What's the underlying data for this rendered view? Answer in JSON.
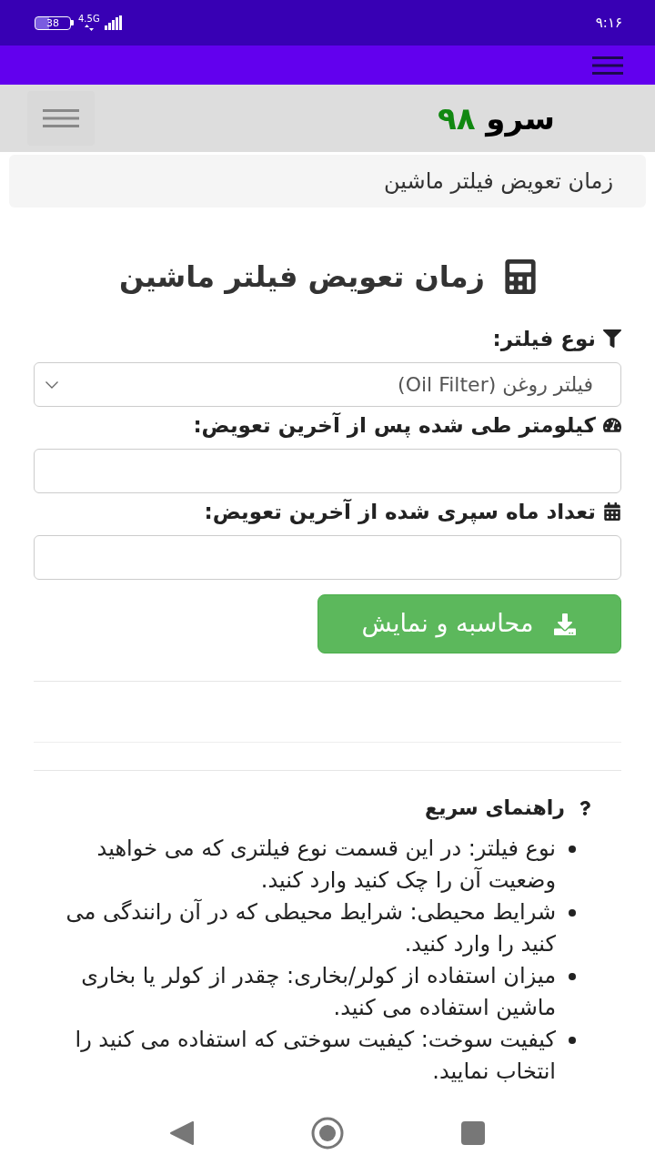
{
  "status_bar": {
    "time": "۹:۱۶",
    "battery": "38",
    "network": "4.5G"
  },
  "site_header": {
    "logo": {
      "word": "سرو",
      "number": "۹۸"
    }
  },
  "breadcrumb": "زمان تعویض فیلتر ماشین",
  "page_title": "زمان تعویض فیلتر ماشین",
  "form": {
    "fields": [
      {
        "kind": "select",
        "label": "نوع فیلتر:",
        "value": "فیلتر روغن (Oil Filter)"
      },
      {
        "kind": "input",
        "label": "کیلومتر طی شده پس از آخرین تعویض:"
      },
      {
        "kind": "input",
        "label": "تعداد ماه سپری شده از آخرین تعویض:"
      }
    ],
    "submit": "محاسبه و نمایش"
  },
  "guide": {
    "title": "راهنمای سریع",
    "items": [
      "نوع فیلتر: در این قسمت نوع فیلتری که می خواهید وضعیت آن را چک کنید وارد کنید.",
      "شرایط محیطی: شرایط محیطی که در آن رانندگی می کنید را وارد کنید.",
      "میزان استفاده از کولر/بخاری: چقدر از کولر یا بخاری ماشین استفاده می کنید.",
      "کیفیت سوخت: کیفیت سوختی که استفاده می کنید را انتخاب نمایید."
    ]
  }
}
